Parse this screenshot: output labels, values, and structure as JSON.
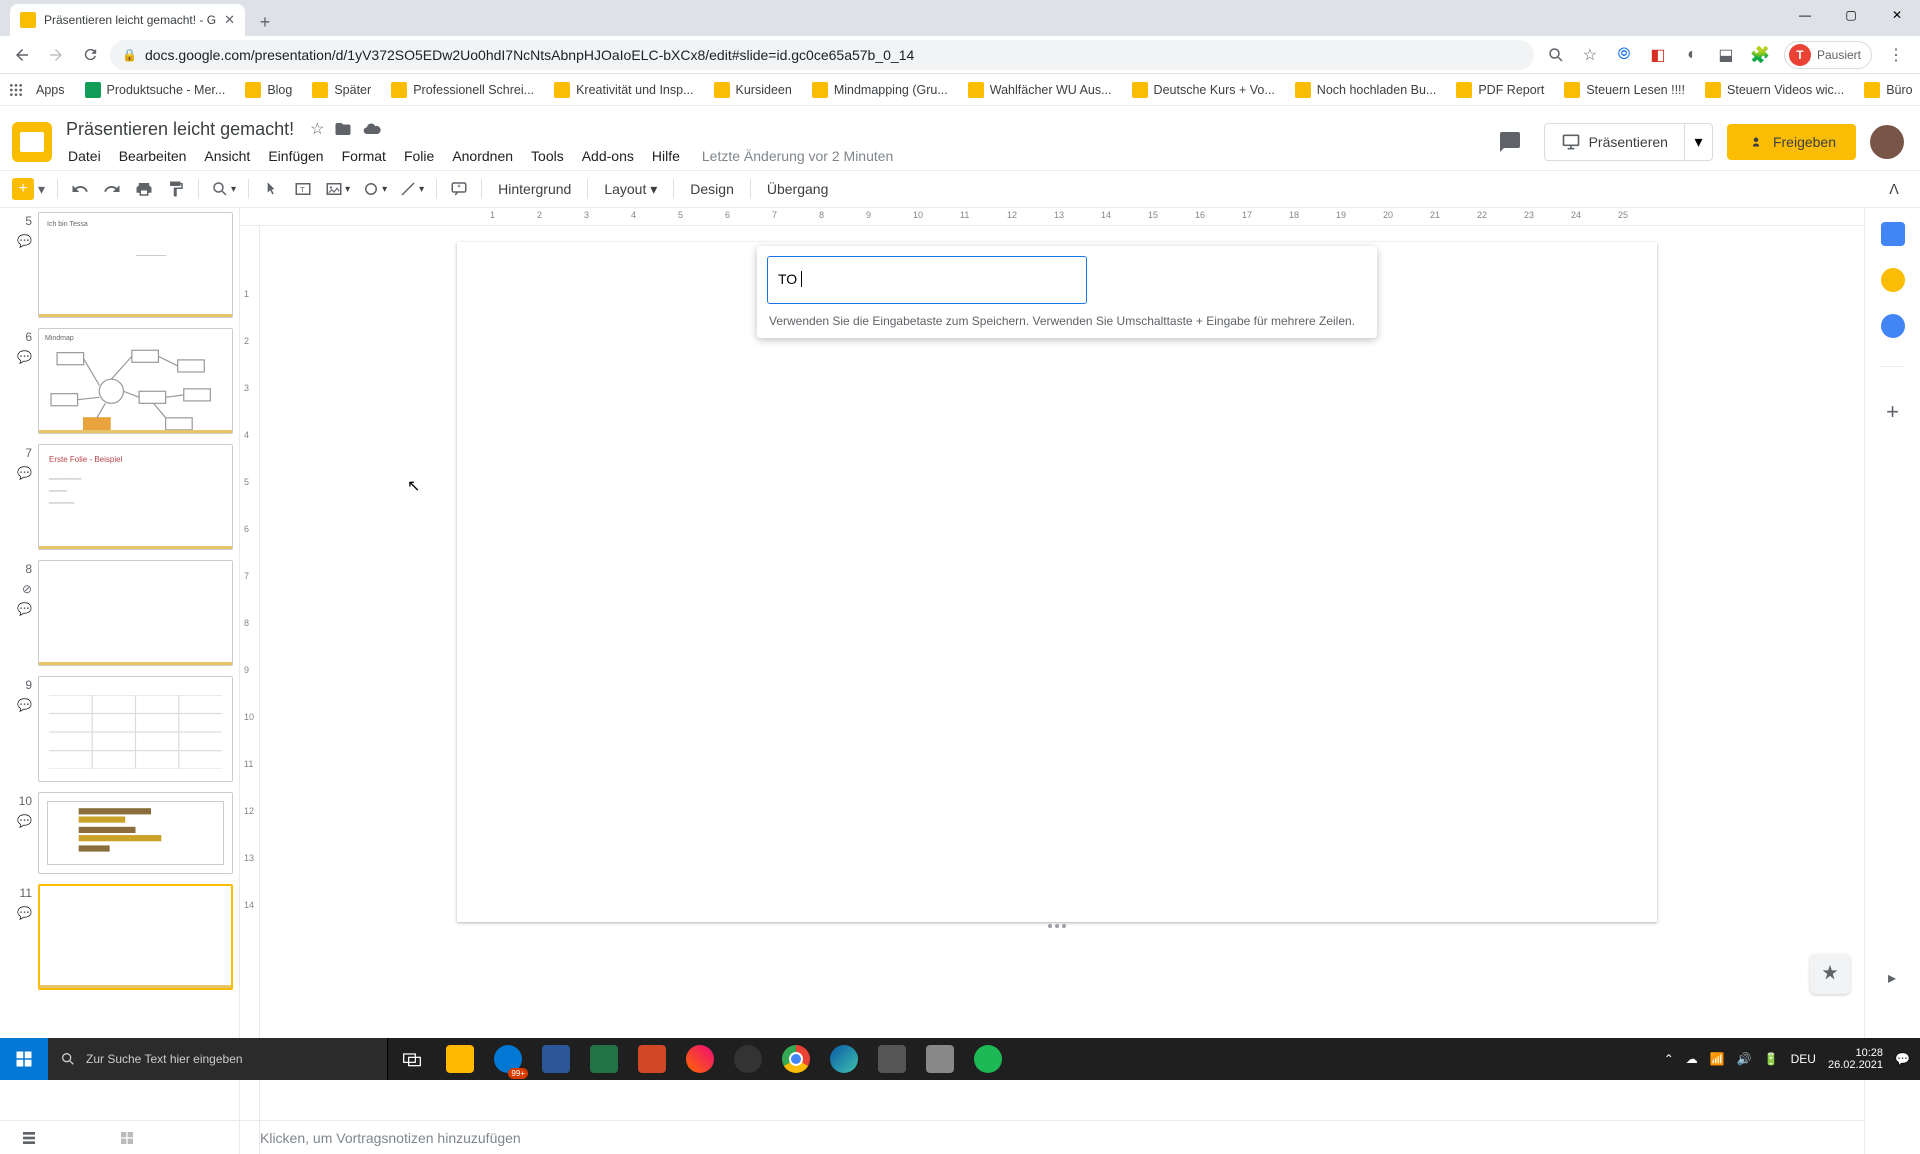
{
  "browser": {
    "tab_title": "Präsentieren leicht gemacht! - G",
    "url": "docs.google.com/presentation/d/1yV372SO5EDw2Uo0hdI7NcNtsAbnpHJOaIoELC-bXCx8/edit#slide=id.gc0ce65a57b_0_14",
    "profile_status": "Pausiert",
    "profile_initial": "T"
  },
  "bookmarks": [
    {
      "label": "Apps",
      "icon": "grid"
    },
    {
      "label": "Produktsuche - Mer...",
      "icon": "green"
    },
    {
      "label": "Blog"
    },
    {
      "label": "Später"
    },
    {
      "label": "Professionell Schrei..."
    },
    {
      "label": "Kreativität und Insp..."
    },
    {
      "label": "Kursideen"
    },
    {
      "label": "Mindmapping  (Gru..."
    },
    {
      "label": "Wahlfächer WU Aus..."
    },
    {
      "label": "Deutsche Kurs + Vo..."
    },
    {
      "label": "Noch hochladen Bu..."
    },
    {
      "label": "PDF Report"
    },
    {
      "label": "Steuern Lesen !!!!"
    },
    {
      "label": "Steuern Videos wic..."
    },
    {
      "label": "Büro"
    }
  ],
  "doc": {
    "title": "Präsentieren leicht gemacht!",
    "last_edit": "Letzte Änderung vor 2 Minuten"
  },
  "menu": [
    "Datei",
    "Bearbeiten",
    "Ansicht",
    "Einfügen",
    "Format",
    "Folie",
    "Anordnen",
    "Tools",
    "Add-ons",
    "Hilfe"
  ],
  "header_buttons": {
    "present": "Präsentieren",
    "share": "Freigeben"
  },
  "toolbar": {
    "background": "Hintergrund",
    "layout": "Layout",
    "design": "Design",
    "transition": "Übergang"
  },
  "comment": {
    "value": "TO",
    "hint": "Verwenden Sie die Eingabetaste zum Speichern. Verwenden Sie Umschalttaste + Eingabe für mehrere Zeilen."
  },
  "notes_placeholder": "Klicken, um Vortragsnotizen hinzuzufügen",
  "slides": [
    {
      "num": "5",
      "label": "Ich bin Tessa"
    },
    {
      "num": "6",
      "label": "Mindmap"
    },
    {
      "num": "7",
      "label": "Erste Folie - Beispiel"
    },
    {
      "num": "8",
      "label": ""
    },
    {
      "num": "9",
      "label": ""
    },
    {
      "num": "10",
      "label": ""
    },
    {
      "num": "11",
      "label": ""
    }
  ],
  "ruler_h": [
    "1",
    "2",
    "3",
    "4",
    "5",
    "6",
    "7",
    "8",
    "9",
    "10",
    "11",
    "12",
    "13",
    "14",
    "15",
    "16",
    "17",
    "18",
    "19",
    "20",
    "21",
    "22",
    "23",
    "24",
    "25"
  ],
  "ruler_v": [
    "1",
    "2",
    "3",
    "4",
    "5",
    "6",
    "7",
    "8",
    "9",
    "10",
    "11",
    "12",
    "13",
    "14"
  ],
  "taskbar": {
    "search_placeholder": "Zur Suche Text hier eingeben",
    "time": "10:28",
    "date": "26.02.2021",
    "lang": "DEU",
    "notif": "99+"
  }
}
